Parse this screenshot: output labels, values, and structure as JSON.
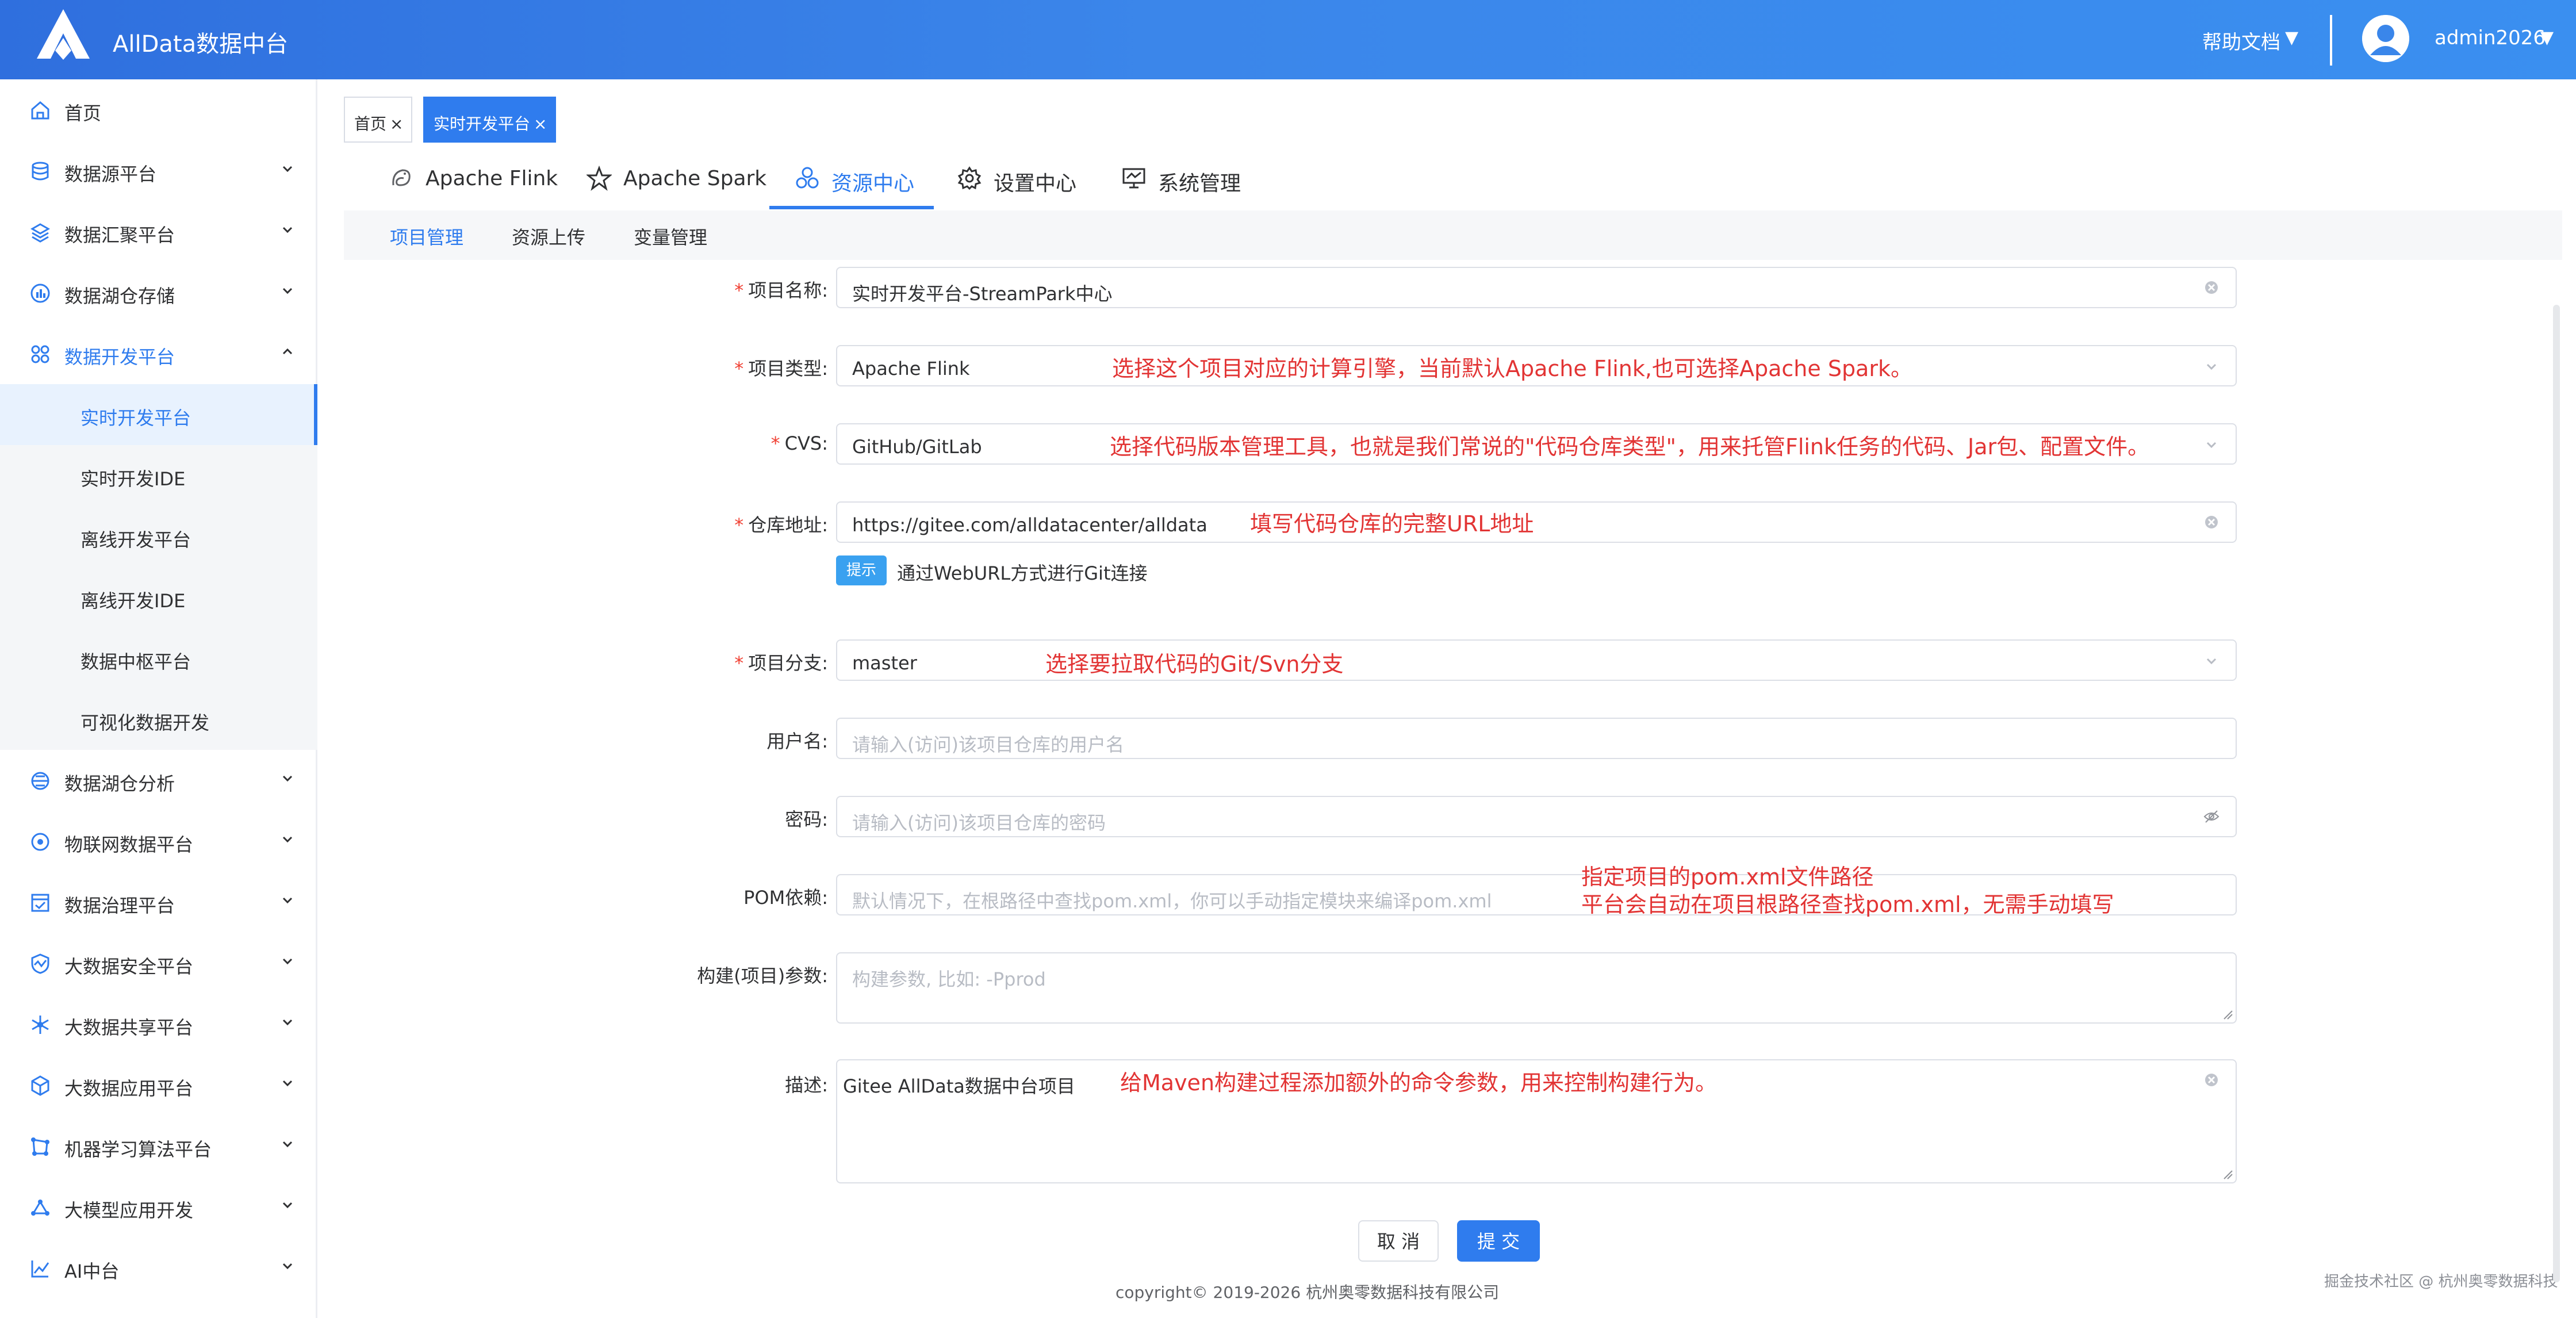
{
  "header": {
    "brand": "AllData数据中台",
    "help": "帮助文档",
    "caret": "▼",
    "user": "admin2026"
  },
  "sidebar": {
    "items": [
      {
        "label": "首页",
        "icon": "home-icon"
      },
      {
        "label": "数据源平台",
        "icon": "database-icon"
      },
      {
        "label": "数据汇聚平台",
        "icon": "layers-icon"
      },
      {
        "label": "数据湖仓存储",
        "icon": "chart-icon"
      },
      {
        "label": "数据开发平台",
        "icon": "apps-icon"
      },
      {
        "label": "数据湖仓分析",
        "icon": "analysis-icon"
      },
      {
        "label": "物联网数据平台",
        "icon": "iot-icon"
      },
      {
        "label": "数据治理平台",
        "icon": "governance-icon"
      },
      {
        "label": "大数据安全平台",
        "icon": "security-icon"
      },
      {
        "label": "大数据共享平台",
        "icon": "share-icon"
      },
      {
        "label": "大数据应用平台",
        "icon": "cube-icon"
      },
      {
        "label": "机器学习算法平台",
        "icon": "ml-icon"
      },
      {
        "label": "大模型应用开发",
        "icon": "llm-icon"
      },
      {
        "label": "AI中台",
        "icon": "ai-icon"
      }
    ],
    "sub_items": [
      {
        "label": "实时开发平台"
      },
      {
        "label": "实时开发IDE"
      },
      {
        "label": "离线开发平台"
      },
      {
        "label": "离线开发IDE"
      },
      {
        "label": "数据中枢平台"
      },
      {
        "label": "可视化数据开发"
      }
    ]
  },
  "tags": [
    {
      "label": "首页",
      "close": "×"
    },
    {
      "label": "实时开发平台",
      "close": "×"
    }
  ],
  "tabs": [
    {
      "label": "Apache Flink",
      "icon": "flink-icon"
    },
    {
      "label": "Apache Spark",
      "icon": "spark-icon"
    },
    {
      "label": "资源中心",
      "icon": "resource-icon"
    },
    {
      "label": "设置中心",
      "icon": "gear-icon"
    },
    {
      "label": "系统管理",
      "icon": "monitor-icon"
    }
  ],
  "subnav": [
    {
      "label": "项目管理"
    },
    {
      "label": "资源上传"
    },
    {
      "label": "变量管理"
    }
  ],
  "form": {
    "required_mark": "*",
    "name": {
      "label": "项目名称:",
      "value": "实时开发平台-StreamPark中心"
    },
    "type": {
      "label": "项目类型:",
      "value": "Apache Flink",
      "note": "选择这个项目对应的计算引擎，当前默认Apache Flink,也可选择Apache Spark。"
    },
    "cvs": {
      "label": "CVS:",
      "value": "GitHub/GitLab",
      "note": "选择代码版本管理工具，也就是我们常说的\"代码仓库类型\"，用来托管Flink任务的代码、Jar包、配置文件。"
    },
    "repo": {
      "label": "仓库地址:",
      "value": "https://gitee.com/alldatacenter/alldata",
      "note": "填写代码仓库的完整URL地址",
      "hint_badge": "提示",
      "hint": "通过WebURL方式进行Git连接"
    },
    "branch": {
      "label": "项目分支:",
      "value": "master",
      "note": "选择要拉取代码的Git/Svn分支"
    },
    "username": {
      "label": "用户名:",
      "placeholder": "请输入(访问)该项目仓库的用户名"
    },
    "password": {
      "label": "密码:",
      "placeholder": "请输入(访问)该项目仓库的密码"
    },
    "pom": {
      "label": "POM依赖:",
      "placeholder": "默认情况下，在根路径中查找pom.xml，你可以手动指定模块来编译pom.xml",
      "note1": "指定项目的pom.xml文件路径",
      "note2": "平台会自动在项目根路径查找pom.xml，无需手动填写"
    },
    "build": {
      "label": "构建(项目)参数:",
      "placeholder": "构建参数, 比如: -Pprod"
    },
    "desc": {
      "label": "描述:",
      "value": "Gitee AllData数据中台项目",
      "note": "给Maven构建过程添加额外的命令参数，用来控制构建行为。"
    }
  },
  "buttons": {
    "cancel": "取 消",
    "submit": "提 交"
  },
  "footer": {
    "copyright": "copyright© 2019-2026 杭州奥零数据科技有限公司",
    "watermark": "掘金技术社区 @ 杭州奥零数据科技"
  },
  "colors": {
    "primary": "#2f7cee",
    "annotation": "#e23434",
    "header": "#3a86ea"
  }
}
